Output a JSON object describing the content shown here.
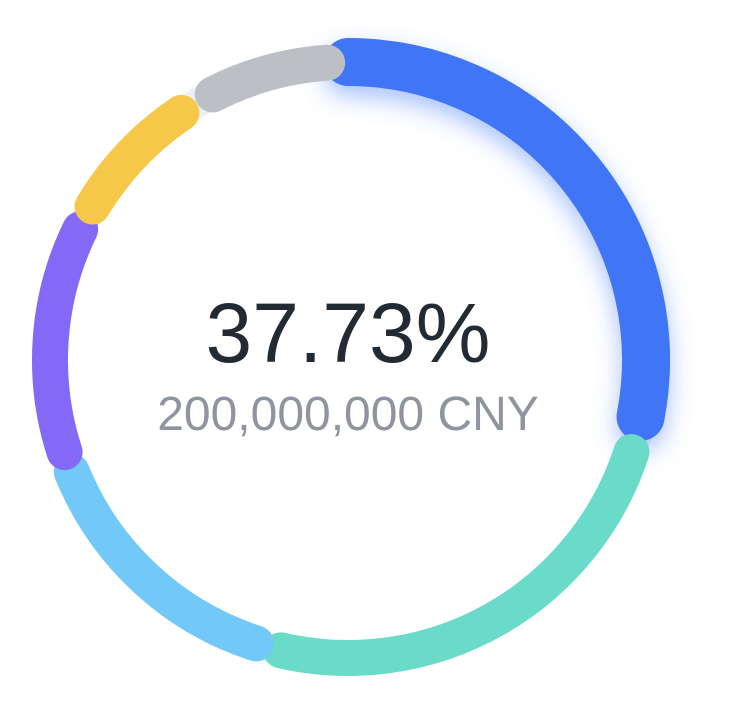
{
  "chart_data": {
    "type": "donut",
    "center_value": "37.73%",
    "center_label": "200,000,000 CNY",
    "segments": [
      {
        "color": "#3f76f5",
        "value": 37.73,
        "highlighted": true
      },
      {
        "color": "#69dbc8"
      },
      {
        "color": "#72c9f7"
      },
      {
        "color": "#8468f6"
      },
      {
        "color": "#f6c748"
      },
      {
        "color": "#bcc0c5"
      }
    ],
    "track_color": "#eef0f3"
  }
}
